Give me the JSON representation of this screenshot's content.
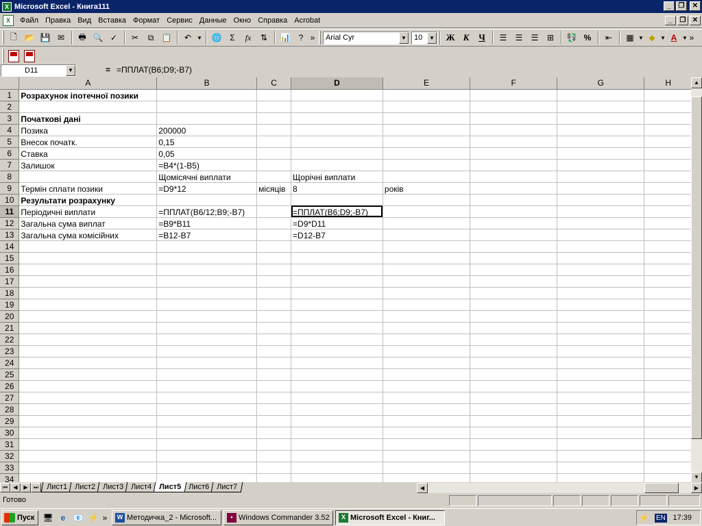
{
  "window": {
    "title": "Microsoft Excel - Книга111",
    "app_icon_letter": "X"
  },
  "menu": {
    "items": [
      "Файл",
      "Правка",
      "Вид",
      "Вставка",
      "Формат",
      "Сервис",
      "Данные",
      "Окно",
      "Справка",
      "Acrobat"
    ]
  },
  "toolbar": {
    "font_name": "Arial Cyr",
    "font_size": "10",
    "sum_symbol": "Σ",
    "function_symbol": "fx",
    "percent_symbol": "%",
    "bold_label": "Ж",
    "italic_label": "К",
    "underline_label": "Ч",
    "font_color_label": "A"
  },
  "formula_bar": {
    "name_box": "D11",
    "equals": "=",
    "formula": "=ППЛАТ(B6;D9;-B7)"
  },
  "columns": [
    "A",
    "B",
    "C",
    "D",
    "E",
    "F",
    "G",
    "H"
  ],
  "active_column": "D",
  "active_row": 11,
  "rows": [
    {
      "n": "1",
      "A": "Розрахунок іпотечної позики",
      "B": "",
      "C": "",
      "D": "",
      "E": "",
      "boldA": true
    },
    {
      "n": "2",
      "A": "",
      "B": "",
      "C": "",
      "D": "",
      "E": ""
    },
    {
      "n": "3",
      "A": "Початкові дані",
      "B": "",
      "C": "",
      "D": "",
      "E": "",
      "boldA": true
    },
    {
      "n": "4",
      "A": "Позика",
      "B": "200000",
      "C": "",
      "D": "",
      "E": ""
    },
    {
      "n": "5",
      "A": "Внесок початк.",
      "B": "0,15",
      "C": "",
      "D": "",
      "E": ""
    },
    {
      "n": "6",
      "A": "Ставка",
      "B": "0,05",
      "C": "",
      "D": "",
      "E": ""
    },
    {
      "n": "7",
      "A": "Залишок",
      "B": "=B4*(1-B5)",
      "C": "",
      "D": "",
      "E": ""
    },
    {
      "n": "8",
      "A": "",
      "B": "Щомісячні виплати",
      "C": "",
      "D": "Щорічні виплати",
      "E": ""
    },
    {
      "n": "9",
      "A": "Термін сплати позики",
      "B": "=D9*12",
      "C": "місяців",
      "D": "8",
      "E": "років"
    },
    {
      "n": "10",
      "A": "Результати розрахунку",
      "B": "",
      "C": "",
      "D": "",
      "E": "",
      "boldA": true
    },
    {
      "n": "11",
      "A": "Періодичні виплати",
      "B": "=ППЛАТ(B6/12;B9;-B7)",
      "C": "",
      "D": "=ППЛАТ(B6;D9;-B7)",
      "E": ""
    },
    {
      "n": "12",
      "A": "Загальна сума виплат",
      "B": "=B9*B11",
      "C": "",
      "D": "=D9*D11",
      "E": ""
    },
    {
      "n": "13",
      "A": "Загальна сума комісійних",
      "B": "=B12-B7",
      "C": "",
      "D": "=D12-B7",
      "E": ""
    },
    {
      "n": "14"
    },
    {
      "n": "15"
    },
    {
      "n": "16"
    },
    {
      "n": "17"
    },
    {
      "n": "18"
    },
    {
      "n": "19"
    },
    {
      "n": "20"
    },
    {
      "n": "21"
    },
    {
      "n": "22"
    },
    {
      "n": "23"
    },
    {
      "n": "24"
    },
    {
      "n": "25"
    },
    {
      "n": "26"
    },
    {
      "n": "27"
    },
    {
      "n": "28"
    },
    {
      "n": "29"
    },
    {
      "n": "30"
    },
    {
      "n": "31"
    },
    {
      "n": "32"
    },
    {
      "n": "33"
    },
    {
      "n": "34"
    }
  ],
  "sheets": {
    "tabs": [
      "Лист1",
      "Лист2",
      "Лист3",
      "Лист4",
      "Лист5",
      "Лист6",
      "Лист7"
    ],
    "active": "Лист5"
  },
  "status": {
    "text": "Готово"
  },
  "taskbar": {
    "start_label": "Пуск",
    "buttons": [
      "Методичка_2 - Microsoft...",
      "Windows Commander 3.52",
      "Microsoft Excel - Книг..."
    ],
    "active_button": "Microsoft Excel - Книг...",
    "language": "EN",
    "clock": "17:39"
  },
  "colors": {
    "title_bar": "#0a246a",
    "face": "#d4d0c8",
    "excel_green": "#1c7a34"
  }
}
